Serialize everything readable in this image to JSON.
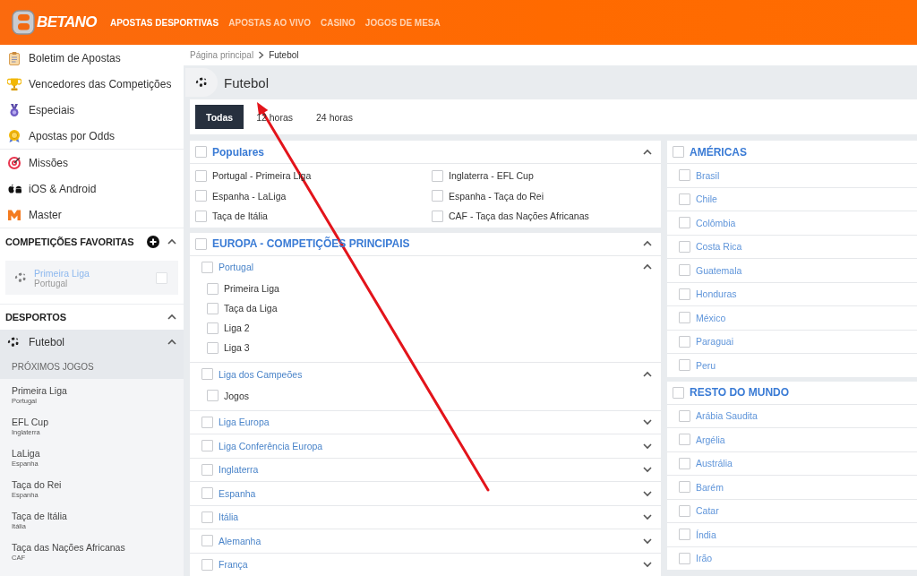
{
  "header": {
    "logo": "BETANO",
    "nav": [
      {
        "label": "APOSTAS DESPORTIVAS",
        "selected": true
      },
      {
        "label": "APOSTAS AO VIVO",
        "selected": false
      },
      {
        "label": "CASINO",
        "selected": false
      },
      {
        "label": "JOGOS DE MESA",
        "selected": false
      }
    ]
  },
  "sidebar": {
    "link_groups": [
      [
        "Boletim de Apostas",
        "Vencedores das Competições",
        "Especiais",
        "Apostas por Odds"
      ],
      [
        "Missões",
        "iOS & Android",
        "Master"
      ]
    ],
    "favorites": {
      "title": "COMPETIÇÕES FAVORITAS",
      "expanded": true,
      "items": [
        {
          "name": "Primeira Liga",
          "country": "Portugal",
          "checked": false
        }
      ]
    },
    "sports": {
      "title": "DESPORTOS",
      "expanded": true,
      "items": [
        {
          "label": "Futebol",
          "expanded": true,
          "section": "PRÓXIMOS JOGOS",
          "competitions": [
            {
              "name": "Primeira Liga",
              "country": "Portugal"
            },
            {
              "name": "EFL Cup",
              "country": "Inglaterra"
            },
            {
              "name": "LaLiga",
              "country": "Espanha"
            },
            {
              "name": "Taça do Rei",
              "country": "Espanha"
            },
            {
              "name": "Taça de Itália",
              "country": "Itália"
            },
            {
              "name": "Taça das Nações Africanas",
              "country": "CAF"
            }
          ]
        }
      ]
    }
  },
  "breadcrumb": [
    "Página principal",
    "Futebol"
  ],
  "page_title": "Futebol",
  "time_filters": [
    {
      "label": "Todas",
      "selected": true
    },
    {
      "label": "12 horas",
      "selected": false
    },
    {
      "label": "24 horas",
      "selected": false
    }
  ],
  "columns": [
    {
      "groups": [
        {
          "kind": "grid",
          "title": "Populares",
          "checked": false,
          "expanded": true,
          "items": [
            {
              "label": "Portugal - Primeira Liga",
              "checked": false
            },
            {
              "label": "Inglaterra - EFL Cup",
              "checked": false
            },
            {
              "label": "Espanha - LaLiga",
              "checked": false
            },
            {
              "label": "Espanha - Taça do Rei",
              "checked": false
            },
            {
              "label": "Taça de Itália",
              "checked": false
            },
            {
              "label": "CAF - Taça das Nações Africanas",
              "checked": false
            }
          ]
        },
        {
          "kind": "tree",
          "title": "EUROPA - COMPETIÇÕES PRINCIPAIS",
          "checked": false,
          "expanded": true,
          "items": [
            {
              "label": "Portugal",
              "checked": false,
              "expanded": true,
              "items": [
                {
                  "label": "Primeira Liga",
                  "checked": false
                },
                {
                  "label": "Taça da Liga",
                  "checked": false
                },
                {
                  "label": "Liga 2",
                  "checked": false
                },
                {
                  "label": "Liga 3",
                  "checked": false
                }
              ]
            },
            {
              "label": "Liga dos Campeões",
              "checked": false,
              "expanded": true,
              "items": [
                {
                  "label": "Jogos",
                  "checked": false
                }
              ]
            },
            {
              "label": "Liga Europa",
              "checked": false,
              "expanded": false
            },
            {
              "label": "Liga Conferência Europa",
              "checked": false,
              "expanded": false
            },
            {
              "label": "Inglaterra",
              "checked": false,
              "expanded": false
            },
            {
              "label": "Espanha",
              "checked": false,
              "expanded": false
            },
            {
              "label": "Itália",
              "checked": false,
              "expanded": false
            },
            {
              "label": "Alemanha",
              "checked": false,
              "expanded": false
            },
            {
              "label": "França",
              "checked": false,
              "expanded": false
            }
          ]
        }
      ]
    },
    {
      "groups": [
        {
          "kind": "tree",
          "title": "AMÉRICAS",
          "checked": false,
          "items": [
            {
              "label": "Brasil",
              "checked": false
            },
            {
              "label": "Chile",
              "checked": false
            },
            {
              "label": "Colômbia",
              "checked": false
            },
            {
              "label": "Costa Rica",
              "checked": false
            },
            {
              "label": "Guatemala",
              "checked": false
            },
            {
              "label": "Honduras",
              "checked": false
            },
            {
              "label": "México",
              "checked": false
            },
            {
              "label": "Paraguai",
              "checked": false
            },
            {
              "label": "Peru",
              "checked": false
            }
          ]
        },
        {
          "kind": "tree",
          "title": "RESTO DO MUNDO",
          "checked": false,
          "items": [
            {
              "label": "Arábia Saudita",
              "checked": false
            },
            {
              "label": "Argélia",
              "checked": false
            },
            {
              "label": "Austrália",
              "checked": false
            },
            {
              "label": "Barém",
              "checked": false
            },
            {
              "label": "Catar",
              "checked": false
            },
            {
              "label": "Índia",
              "checked": false
            },
            {
              "label": "Irão",
              "checked": false
            }
          ]
        }
      ]
    }
  ],
  "annotations": [
    {
      "kind": "arrow"
    }
  ]
}
